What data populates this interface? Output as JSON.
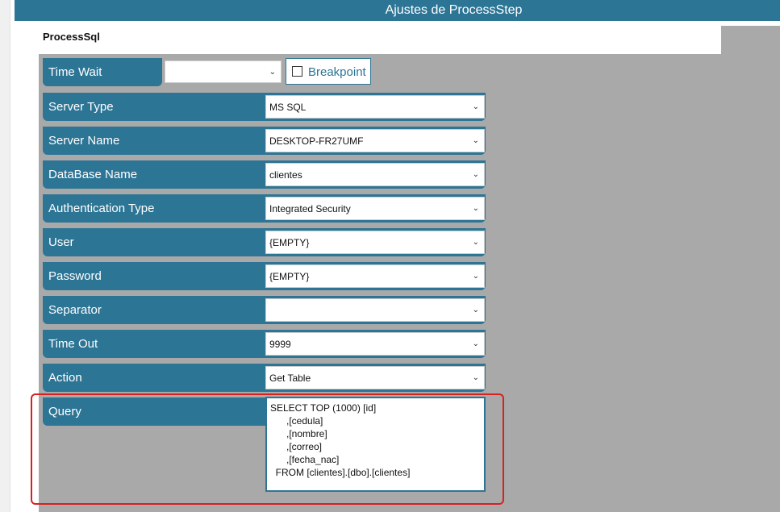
{
  "window": {
    "title": "Ajustes de ProcessStep"
  },
  "section": {
    "title": "ProcessSql"
  },
  "time_wait": {
    "label": "Time Wait",
    "value": ""
  },
  "breakpoint": {
    "label": "Breakpoint",
    "checked": false
  },
  "fields": [
    {
      "label": "Server Type",
      "value": "MS SQL"
    },
    {
      "label": "Server Name",
      "value": "DESKTOP-FR27UMF"
    },
    {
      "label": "DataBase Name",
      "value": "clientes"
    },
    {
      "label": "Authentication Type",
      "value": "Integrated Security"
    },
    {
      "label": "User",
      "value": "{EMPTY}"
    },
    {
      "label": "Password",
      "value": "{EMPTY}"
    },
    {
      "label": "Separator",
      "value": ""
    },
    {
      "label": "Time Out",
      "value": "9999"
    },
    {
      "label": "Action",
      "value": "Get Table"
    }
  ],
  "query": {
    "label": "Query",
    "value": "SELECT TOP (1000) [id]\n      ,[cedula]\n      ,[nombre]\n      ,[correo]\n      ,[fecha_nac]\n  FROM [clientes].[dbo].[clientes]"
  },
  "colors": {
    "accent": "#2d7595",
    "highlight": "#d92020",
    "background": "#a9a9a9"
  },
  "icons": {
    "dropdown": "chevron-down-icon"
  }
}
